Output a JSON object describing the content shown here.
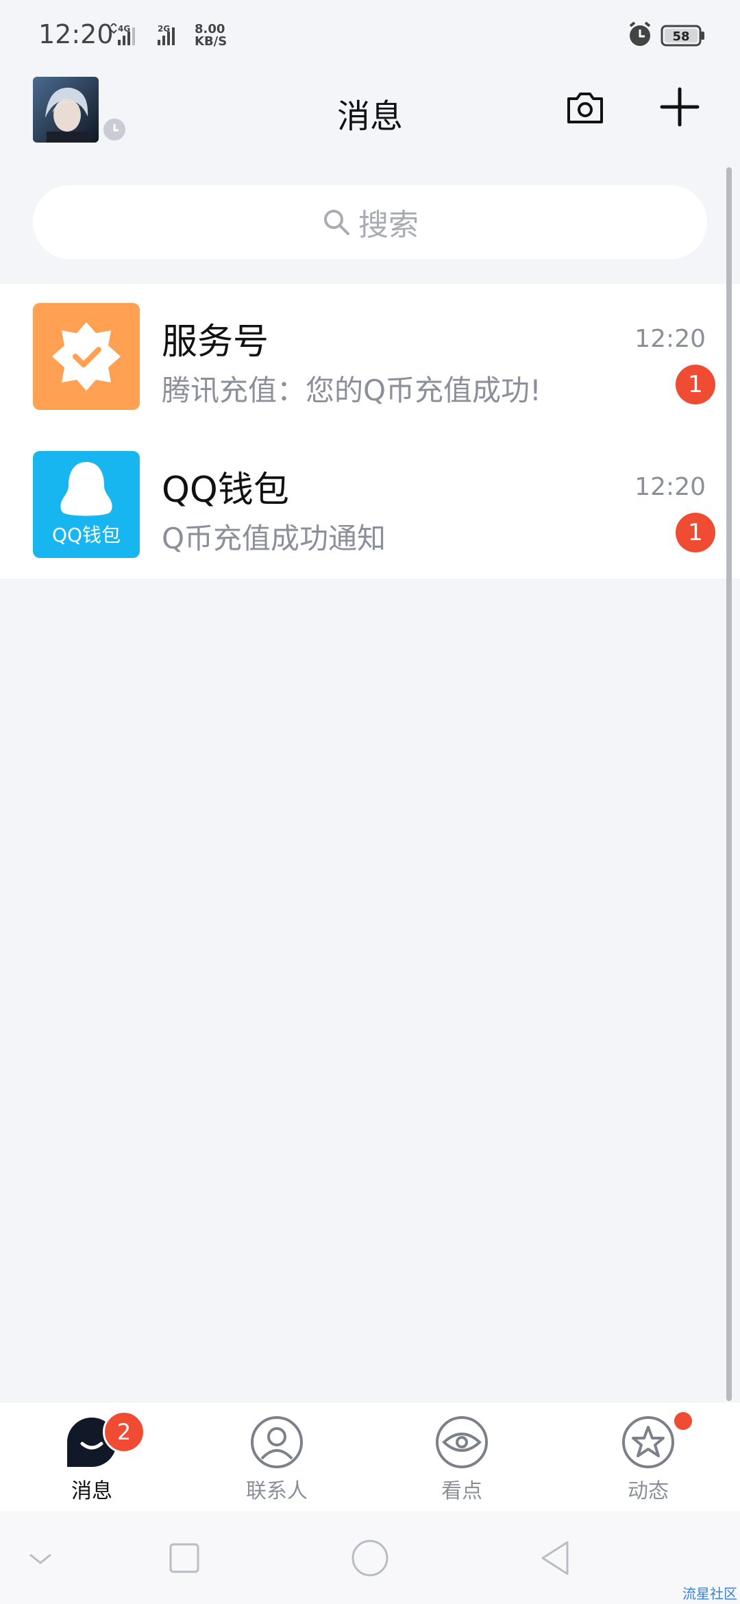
{
  "status_bar": {
    "time": "12:20",
    "network_1": "4G",
    "network_2": "2G",
    "speed_value": "8.00",
    "speed_unit": "KB/S",
    "battery": "58"
  },
  "header": {
    "title": "消息"
  },
  "search": {
    "placeholder": "搜索"
  },
  "conversations": [
    {
      "name": "服务号",
      "preview": "腾讯充值：您的Q币充值成功!",
      "time": "12:20",
      "unread": "1",
      "icon": "service-account-icon",
      "color": "#ffa052"
    },
    {
      "name": "QQ钱包",
      "preview": "Q币充值成功通知",
      "time": "12:20",
      "unread": "1",
      "icon": "qq-wallet-icon",
      "color": "#18b6f0",
      "icon_text": "QQ钱包"
    }
  ],
  "tabs": [
    {
      "label": "消息",
      "icon": "message-icon",
      "badge": "2",
      "active": true
    },
    {
      "label": "联系人",
      "icon": "contacts-icon"
    },
    {
      "label": "看点",
      "icon": "eye-icon"
    },
    {
      "label": "动态",
      "icon": "star-icon",
      "dot": true
    }
  ],
  "nav_bar": [
    "back-icon",
    "recents-icon",
    "home-icon",
    "back-triangle-icon"
  ],
  "watermark": "流星社区",
  "colors": {
    "badge": "#f04b33",
    "background": "#f4f5f9"
  }
}
